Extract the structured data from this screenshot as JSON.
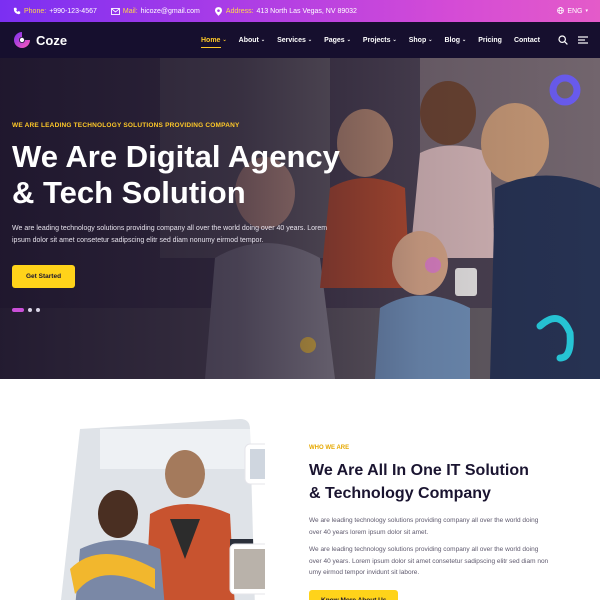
{
  "topbar": {
    "phone_label": "Phone:",
    "phone": "+990-123-4567",
    "mail_label": "Mail:",
    "mail": "hicoze@gmail.com",
    "address_label": "Address:",
    "address": "413 North Las Vegas, NV 89032",
    "lang": "ENG"
  },
  "nav": {
    "logo": "Coze",
    "items": [
      {
        "label": "Home",
        "dropdown": true
      },
      {
        "label": "About",
        "dropdown": true
      },
      {
        "label": "Services",
        "dropdown": true
      },
      {
        "label": "Pages",
        "dropdown": true
      },
      {
        "label": "Projects",
        "dropdown": true
      },
      {
        "label": "Shop",
        "dropdown": true
      },
      {
        "label": "Blog",
        "dropdown": true
      },
      {
        "label": "Pricing",
        "dropdown": false
      },
      {
        "label": "Contact",
        "dropdown": false
      }
    ],
    "active_index": 0
  },
  "hero": {
    "kicker": "WE ARE LEADING TECHNOLOGY SOLUTIONS PROVIDING COMPANY",
    "title_line1": "We Are Digital Agency",
    "title_line2": "& Tech Solution",
    "desc": "We are leading technology solutions providing company all over the world doing over 40 years. Lorem ipsum dolor sit amet consetetur sadipscing elitr sed diam nonumy eirmod tempor.",
    "cta": "Get Started",
    "slides": 3,
    "active_slide": 0
  },
  "about": {
    "kicker": "WHO WE ARE",
    "title_line1": "We Are All In One IT Solution",
    "title_line2": "& Technology Company",
    "p1": "We are leading technology solutions providing company all over the world doing over 40 years lorem ipsum dolor sit amet.",
    "p2": "We are leading technology solutions providing company all over the world doing over 40 years. Lorem ipsum dolor sit amet consetetur sadipscing elitr sed diam non umy eirmod tempor invidunt sit labore.",
    "cta": "Know More About Us"
  },
  "colors": {
    "accent_yellow": "#ffd31a",
    "nav_bg": "#160f2e",
    "topbar_start": "#7b2ff2",
    "topbar_end": "#e45bc9",
    "kicker": "#ffc928"
  }
}
